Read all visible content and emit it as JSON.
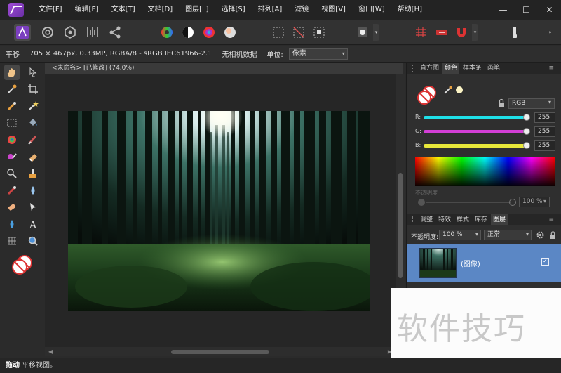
{
  "menu": {
    "items": [
      "文件[F]",
      "编辑[E]",
      "文本[T]",
      "文档[D]",
      "图层[L]",
      "选择[S]",
      "排列[A]",
      "滤镜",
      "视图[V]",
      "窗口[W]",
      "帮助[H]"
    ],
    "window_buttons": [
      "—",
      "☐",
      "✕"
    ]
  },
  "context": {
    "tool": "平移",
    "image_info": "705 × 467px, 0.33MP, RGBA/8 - sRGB IEC61966-2.1",
    "meta": "无相机数据",
    "unit_label": "单位:",
    "unit_value": "像素"
  },
  "document": {
    "tab_title": "<未命名> [已修改] (74.0%)"
  },
  "color_panel": {
    "tabs": [
      "直方图",
      "颜色",
      "样本条",
      "画笔"
    ],
    "active_tab": "颜色",
    "mode": "RGB",
    "r_label": "R:",
    "r_value": "255",
    "g_label": "G:",
    "g_value": "255",
    "b_label": "B:",
    "b_value": "255",
    "opacity_label": "不透明度",
    "opacity_value": "100 %"
  },
  "layers_panel": {
    "tabs": [
      "调整",
      "特效",
      "样式",
      "库存",
      "图层"
    ],
    "active_tab": "图层",
    "opacity_label": "不透明度:",
    "opacity_value": "100 %",
    "blend_mode": "正常",
    "layer_name": "(图像)",
    "layer_visible": "✓"
  },
  "watermark": "软件技巧",
  "status": {
    "action": "拖动",
    "description": "平移视图。"
  },
  "colors": {
    "accent": "#5b87c5",
    "r_track": "#1fe0e8",
    "g_track": "#d33fd6",
    "b_track": "#e8e83a"
  }
}
